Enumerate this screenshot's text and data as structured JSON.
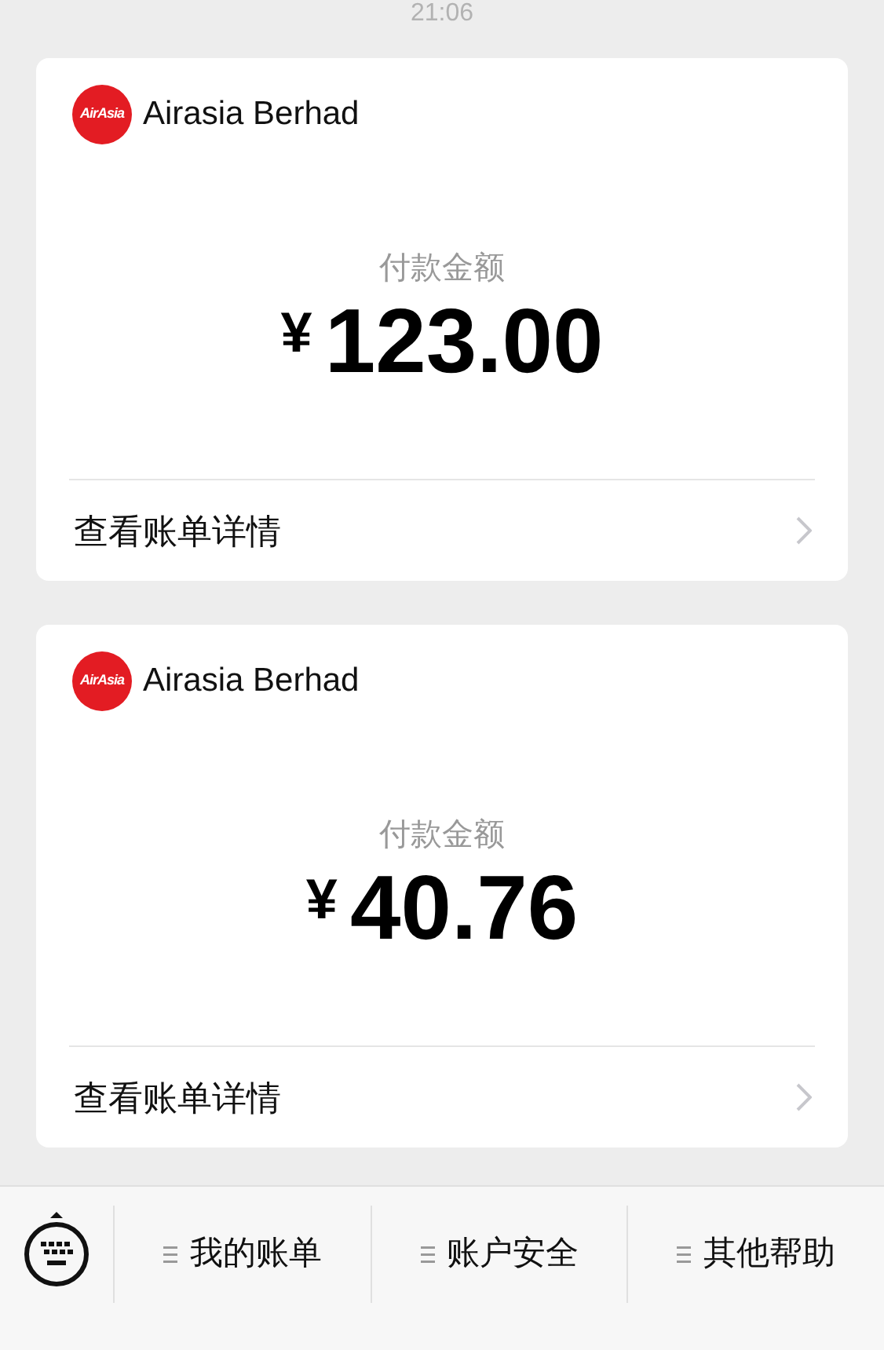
{
  "time": "21:06",
  "bills": [
    {
      "logo_text": "AirAsia",
      "merchant": "Airasia Berhad",
      "amount_label": "付款金额",
      "currency": "¥",
      "amount": "123.00",
      "link": "查看账单详情"
    },
    {
      "logo_text": "AirAsia",
      "merchant": "Airasia Berhad",
      "amount_label": "付款金额",
      "currency": "¥",
      "amount": "40.76",
      "link": "查看账单详情"
    }
  ],
  "menu": [
    "我的账单",
    "账户安全",
    "其他帮助"
  ]
}
